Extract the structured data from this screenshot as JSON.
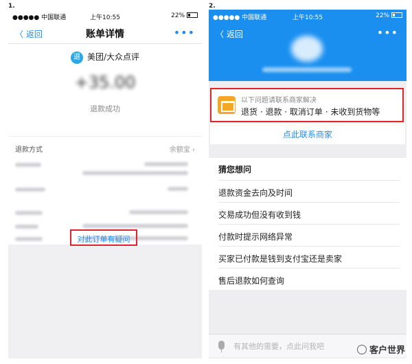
{
  "step_labels": [
    "1.",
    "2."
  ],
  "left": {
    "status": {
      "carrier": "●●●●● 中国联通",
      "time": "上午10:55",
      "battery": "22%"
    },
    "nav": {
      "back": "〈 返回",
      "title": "账单详情",
      "more": "•••"
    },
    "merchant": {
      "badge": "退",
      "name": "美团/大众点评"
    },
    "amount": "+35.00",
    "status_text": "退款成功",
    "refund_method": {
      "label": "退款方式",
      "value": "余额宝 ›"
    },
    "question_link": "对此订单有疑问"
  },
  "right": {
    "status": {
      "carrier": "●●●●● 中国联通",
      "time": "上午10:55",
      "battery": "22%"
    },
    "nav": {
      "back": "〈 返回",
      "more": "•••"
    },
    "notice": {
      "title": "以下问题请联系商家解决",
      "items": "退货 · 退款 · 取消订单 · 未收到货物等"
    },
    "contact_link": "点此联系商家",
    "faq": {
      "heading": "猜您想问",
      "items": [
        "退款资金去向及时间",
        "交易成功但没有收到钱",
        "付款时提示网络异常",
        "买家已付款是钱到支付宝还是卖家",
        "售后退款如何查询"
      ]
    },
    "input_placeholder": "有其他的需要，点此问我吧"
  },
  "watermark": "客户世界",
  "colors": {
    "accent_blue": "#1f8cf0",
    "header_blue": "#1a8ff0",
    "highlight_red": "#e0232b",
    "shop_orange": "#f5a623"
  }
}
